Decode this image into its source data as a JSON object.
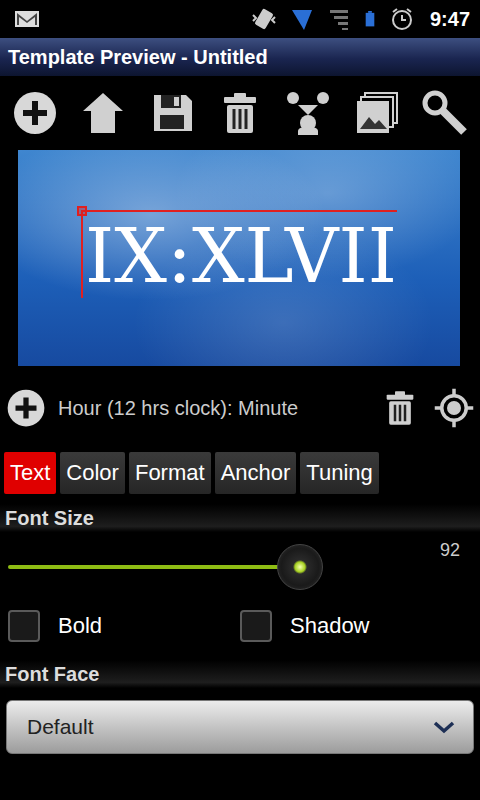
{
  "status_bar": {
    "time": "9:47"
  },
  "window": {
    "title": "Template Preview - Untitled"
  },
  "preview": {
    "text": "IX:XLVII",
    "selected": true
  },
  "element": {
    "label": "Hour (12 hrs clock): Minute"
  },
  "tabs": [
    {
      "label": "Text",
      "selected": true
    },
    {
      "label": "Color",
      "selected": false
    },
    {
      "label": "Format",
      "selected": false
    },
    {
      "label": "Anchor",
      "selected": false
    },
    {
      "label": "Tuning",
      "selected": false
    }
  ],
  "font_size": {
    "label": "Font Size",
    "level": 0.63,
    "reading": "92"
  },
  "options": [
    {
      "label": "Bold",
      "checked": false
    },
    {
      "label": "Shadow",
      "checked": false
    }
  ],
  "font_face": {
    "label": "Font Face",
    "value": "Default"
  }
}
